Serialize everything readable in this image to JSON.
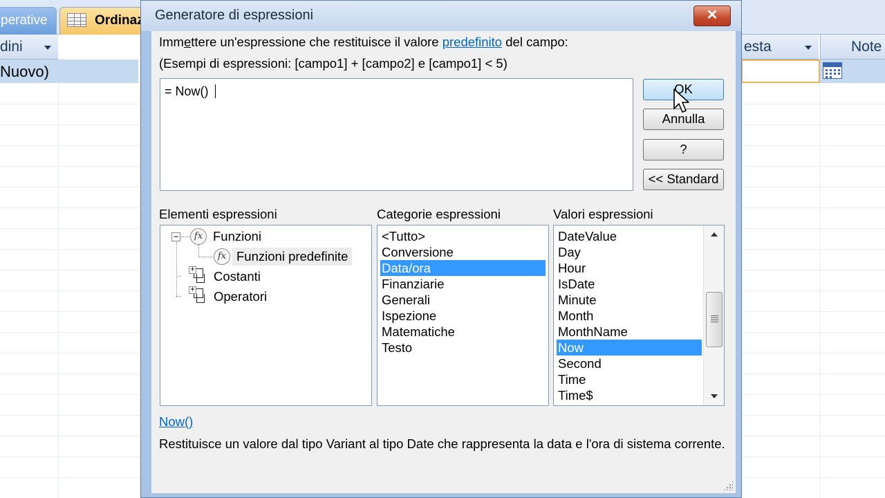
{
  "background": {
    "tabs": [
      {
        "label": "perative"
      },
      {
        "label": "Ordinaz"
      }
    ],
    "columns": {
      "left_header": "dini",
      "right_header": "esta",
      "note_header": "Note"
    },
    "new_row_label": "Nuovo)"
  },
  "dialog": {
    "title": "Generatore di espressioni",
    "close_label": "✕",
    "instruction": {
      "prefix_u": "Imm",
      "prefix_underlined_char": "e",
      "prefix_rest": "ttere un'espressione che restituisce il valore ",
      "link": "predefinito",
      "suffix": " del campo:"
    },
    "examples": "(Esempi di espressioni: [campo1] + [campo2] e [campo1] < 5)",
    "expression": "= Now() ",
    "buttons": {
      "ok": "OK",
      "cancel": "Annulla",
      "help": "?",
      "standard": "<< Standard"
    },
    "labels": {
      "elements": "Elementi espressioni",
      "categories": "Categorie espressioni",
      "values": "Valori espressioni"
    },
    "tree": [
      {
        "label": "Funzioni",
        "expander": "−",
        "icon": "fx-icon"
      },
      {
        "label": "Funzioni predefinite",
        "icon": "fx-icon",
        "selected": true
      },
      {
        "label": "Costanti",
        "expander": "+",
        "icon": "folder-icon"
      },
      {
        "label": "Operatori",
        "expander": "+",
        "icon": "folder-icon"
      }
    ],
    "categories": [
      "<Tutto>",
      "Conversione",
      "Data/ora",
      "Finanziarie",
      "Generali",
      "Ispezione",
      "Matematiche",
      "Testo"
    ],
    "categories_selected": "Data/ora",
    "values": [
      "DateValue",
      "Day",
      "Hour",
      "IsDate",
      "Minute",
      "Month",
      "MonthName",
      "Now",
      "Second",
      "Time",
      "Time$"
    ],
    "values_selected": "Now",
    "function_link": "Now()",
    "description": "Restituisce un valore dal tipo Variant al tipo Date che rappresenta la data e l'ora di sistema corrente.",
    "colors": {
      "selection": "#3399ff",
      "link": "#0066cc",
      "frame": "#a9c3e6"
    }
  }
}
